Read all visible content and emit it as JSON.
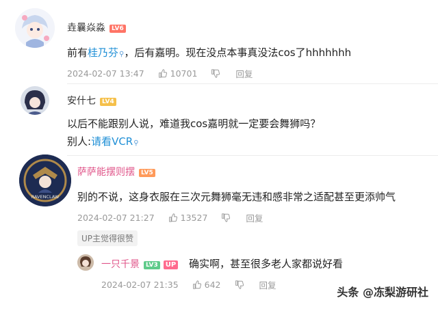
{
  "comments": [
    {
      "username": "垚曩焱淼",
      "level": "LV6",
      "content_before": "前有",
      "content_link": "桂乃芬",
      "content_after": "，后有嘉明。现在没点本事真没法cos了hhhhhhh",
      "date": "2024-02-07 13:47",
      "likes": "10701",
      "reply_label": "回复"
    },
    {
      "username": "安什七",
      "level": "LV4",
      "content_line1": "以后不能跟别人说，难道我cos嘉明就一定要会舞狮吗？",
      "content_line2_prefix": "别人:",
      "content_line2_link": "请看VCR"
    },
    {
      "username": "萨萨能摆则摆",
      "level": "LV5",
      "avatar_text": "RAVENCLAW",
      "content": "别的不说，这身衣服在三次元舞狮毫无违和感非常之适配甚至更添帅气",
      "date": "2024-02-07 21:27",
      "likes": "13527",
      "reply_label": "回复",
      "up_liked": "UP主觉得很赞"
    }
  ],
  "reply": {
    "username": "一只千景",
    "level": "LV3",
    "up_badge": "UP",
    "content": "确实啊，甚至很多老人家都说好看",
    "date": "2024-02-07 21:35",
    "likes": "642",
    "reply_label": "回复"
  },
  "watermark": "头条 @冻梨游研社"
}
